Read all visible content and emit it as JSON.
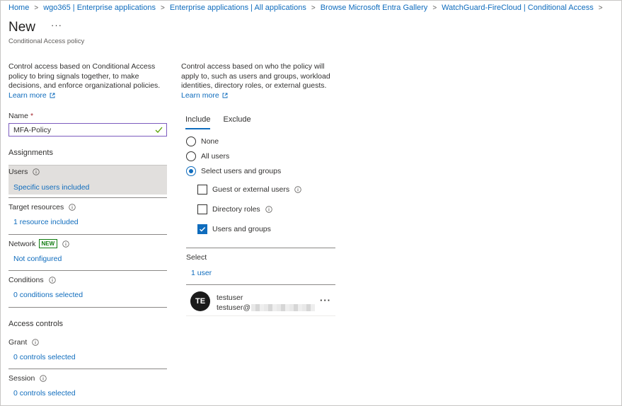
{
  "breadcrumb": [
    "Home",
    "wgo365 | Enterprise applications",
    "Enterprise applications | All applications",
    "Browse Microsoft Entra Gallery",
    "WatchGuard-FireCloud | Conditional Access"
  ],
  "header": {
    "title": "New",
    "more": "···",
    "subtitle": "Conditional Access policy"
  },
  "left": {
    "description": "Control access based on Conditional Access policy to bring signals together, to make decisions, and enforce organizational policies.",
    "learn_more": "Learn more",
    "name_label": "Name",
    "name_required": "*",
    "name_value": "MFA-Policy",
    "assignments_heading": "Assignments",
    "items": [
      {
        "title": "Users",
        "value": "Specific users included"
      },
      {
        "title": "Target resources",
        "value": "1 resource included"
      },
      {
        "title": "Network",
        "badge": "NEW",
        "value": "Not configured"
      },
      {
        "title": "Conditions",
        "value": "0 conditions selected"
      }
    ],
    "access_heading": "Access controls",
    "access_items": [
      {
        "title": "Grant",
        "value": "0 controls selected"
      },
      {
        "title": "Session",
        "value": "0 controls selected"
      }
    ]
  },
  "right": {
    "description": "Control access based on who the policy will apply to, such as users and groups, workload identities, directory roles, or external guests.",
    "learn_more": "Learn more",
    "tabs": [
      "Include",
      "Exclude"
    ],
    "radios": [
      "None",
      "All users",
      "Select users and groups"
    ],
    "selected_radio": "Select users and groups",
    "checkboxes": [
      {
        "label": "Guest or external users",
        "checked": false
      },
      {
        "label": "Directory roles",
        "checked": false
      },
      {
        "label": "Users and groups",
        "checked": true
      }
    ],
    "select_label": "Select",
    "select_value": "1 user",
    "user": {
      "initials": "TE",
      "name": "testuser",
      "email": "testuser@",
      "more": "···"
    }
  },
  "colors": {
    "accent": "#0f6cbd",
    "new_badge": "#107c10",
    "selected_bg": "#e1dfdd"
  }
}
